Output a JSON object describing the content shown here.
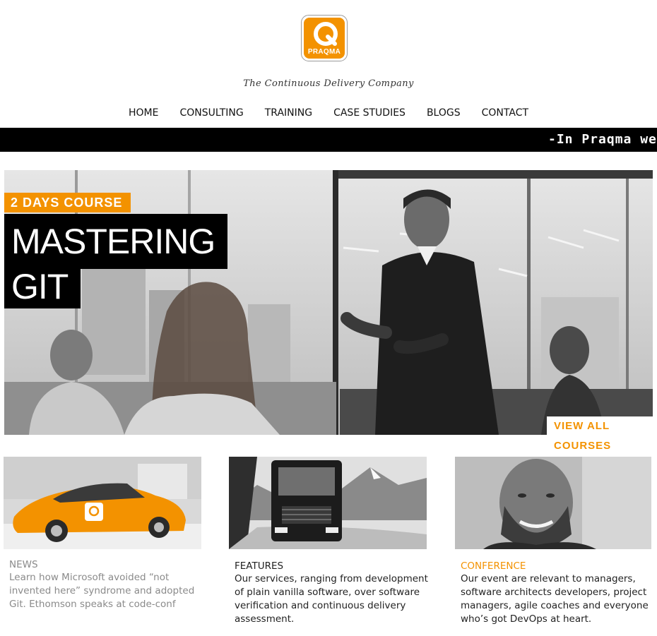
{
  "brand": {
    "logo_letter": "Q",
    "logo_word": "PRAQMA",
    "tagline": "The Continuous Delivery Company",
    "accent_color": "#f39200"
  },
  "nav": {
    "items": [
      "HOME",
      "CONSULTING",
      "TRAINING",
      "CASE STUDIES",
      "BLOGS",
      "CONTACT"
    ]
  },
  "ticker": {
    "text": "-In Praqma we"
  },
  "hero": {
    "badge": "2 DAYS COURSE",
    "title_line1": "MASTERING",
    "title_line2": "GIT",
    "cta": "VIEW ALL COURSES"
  },
  "cards": [
    {
      "heading": "NEWS",
      "body": "Learn how Microsoft avoided “not invented here” syndrome and adopted Git. Ethomson speaks at code-conf"
    },
    {
      "heading": "FEATURES",
      "body": "Our services, ranging from development of plain vanilla software, over software verification and continuous delivery assessment."
    },
    {
      "heading": "CONFERENCE",
      "body": "Our event are relevant to managers, software architects developers, project managers, agile coaches and everyone who’s got DevOps at heart."
    }
  ]
}
